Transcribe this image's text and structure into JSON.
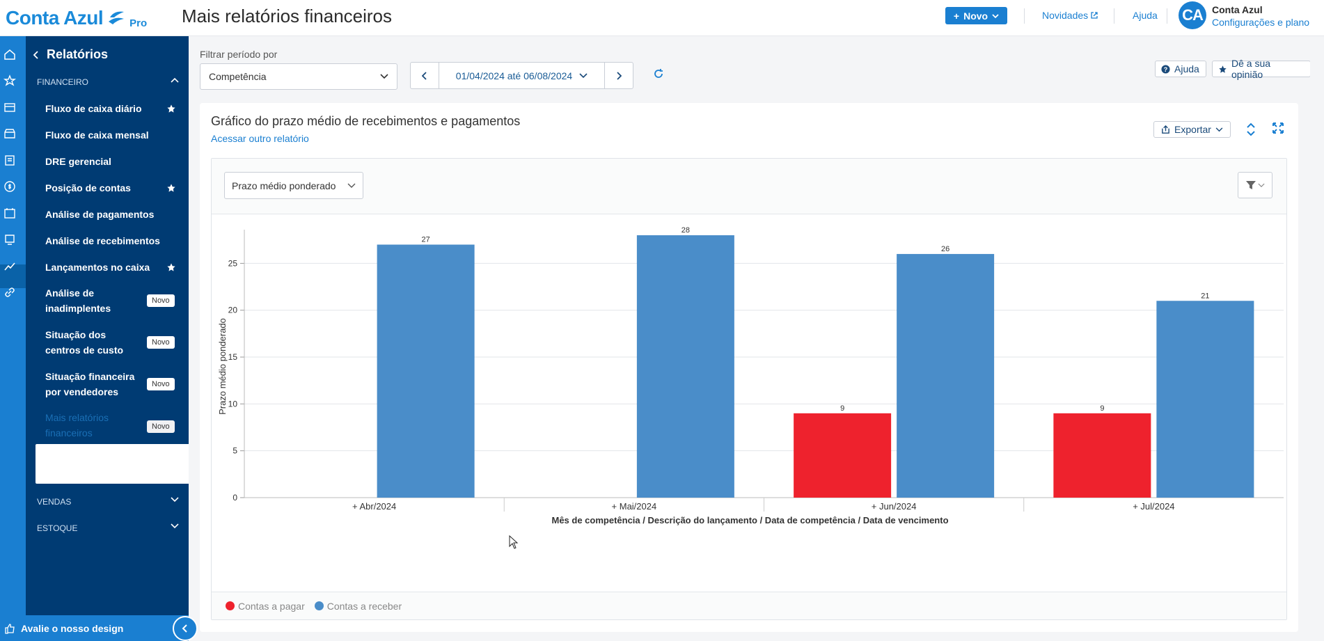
{
  "header": {
    "logo_text": "Conta Azul",
    "logo_badge": "Pro",
    "page_title": "Mais relatórios financeiros",
    "new_button": "Novo",
    "news_link": "Novidades",
    "help_link": "Ajuda",
    "avatar_initials": "CA",
    "user_name": "Conta Azul",
    "user_settings": "Configurações e plano"
  },
  "sidebar": {
    "back_title": "Relatórios",
    "section_financeiro": "FINANCEIRO",
    "items": [
      {
        "label": "Fluxo de caixa diário",
        "starred": true
      },
      {
        "label": "Fluxo de caixa mensal",
        "starred": false
      },
      {
        "label": "DRE gerencial",
        "starred": false
      },
      {
        "label": "Posição de contas",
        "starred": true
      },
      {
        "label": "Análise de pagamentos",
        "starred": false
      },
      {
        "label": "Análise de recebimentos",
        "starred": false
      },
      {
        "label": "Lançamentos no caixa",
        "starred": true
      },
      {
        "label": "Análise de inadimplentes",
        "badge": "Novo"
      },
      {
        "label": "Situação dos centros de custo",
        "badge": "Novo"
      },
      {
        "label": "Situação financeira por vendedores",
        "badge": "Novo"
      },
      {
        "label": "Mais relatórios financeiros",
        "badge": "Novo",
        "selected": true
      }
    ],
    "section_vendas": "VENDAS",
    "section_estoque": "ESTOQUE",
    "feedback": "Avalie o nosso design"
  },
  "filters": {
    "period_label": "Filtrar período por",
    "period_value": "Competência",
    "date_range": "01/04/2024 até 06/08/2024",
    "help_button": "Ajuda",
    "opinion_button": "Dê a sua opinião"
  },
  "report": {
    "title": "Gráfico do prazo médio de recebimentos e pagamentos",
    "other_report_link": "Acessar outro relatório",
    "export_button": "Exportar",
    "metric_select": "Prazo médio ponderado"
  },
  "colors": {
    "pagar": "#ee222d",
    "receber": "#4a8dc9",
    "brand": "#1a7fd1",
    "sidebar": "#003b73"
  },
  "chart_data": {
    "type": "bar",
    "categories": [
      "+ Abr/2024",
      "+ Mai/2024",
      "+ Jun/2024",
      "+ Jul/2024"
    ],
    "series": [
      {
        "name": "Contas a pagar",
        "values": [
          null,
          null,
          9,
          9
        ]
      },
      {
        "name": "Contas a receber",
        "values": [
          27,
          28,
          26,
          21
        ]
      }
    ],
    "data_labels": [
      [
        "",
        "",
        "9",
        "9"
      ],
      [
        "27",
        "28",
        "26",
        "21"
      ]
    ],
    "ylabel": "Prazo médio ponderado",
    "xlabel": "Mês de competência / Descrição do lançamento / Data de competência / Data de vencimento",
    "yticks": [
      0,
      5,
      10,
      15,
      20,
      25
    ],
    "ylim": [
      0,
      28
    ],
    "grid": true,
    "legend": "bottom-left"
  }
}
